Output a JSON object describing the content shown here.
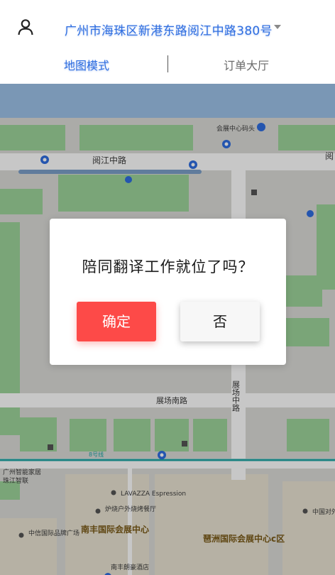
{
  "header": {
    "address": "广州市海珠区新港东路阅江中路380号",
    "tabs": [
      "地图模式",
      "订单大厅"
    ]
  },
  "map": {
    "labels": {
      "dock": "会展中心码头",
      "road_yuejiang": "阅江中路",
      "road_yuejiang_right": "阅",
      "road_zhanguan_south": "展场南路",
      "road_zhanguan_middle": "展场中路",
      "metro_line": "8号线",
      "smart_home": "广州智能家居",
      "pearl_river": "珠江智联",
      "lavazza": "LAVAZZA Espression",
      "restaurant": "炉烧户外烧烤餐厅",
      "zhongxin": "中信国际品牌广场",
      "nanfeng": "南丰国际会展中心",
      "pazhou_c": "琶洲国际会展中心c区",
      "nanfeng_hotel": "南丰朗豪酒店",
      "zhongguo_duiwai": "中国对外广州展览"
    },
    "colors": {
      "land": "#dcdcd8",
      "green": "#9dd49a",
      "water": "#9dc2e8",
      "road": "#ffffff",
      "metro": "#1fa6a4"
    }
  },
  "dialog": {
    "title": "陪同翻译工作就位了吗？",
    "confirm": "确定",
    "cancel": "否"
  }
}
